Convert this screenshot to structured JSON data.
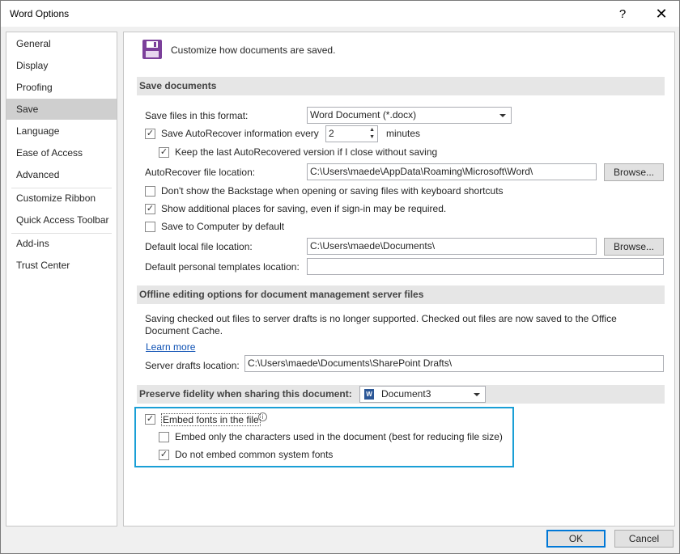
{
  "window": {
    "title": "Word Options",
    "help_label": "?",
    "close_label": "✕"
  },
  "sidebar": {
    "items": [
      {
        "label": "General"
      },
      {
        "label": "Display"
      },
      {
        "label": "Proofing"
      },
      {
        "label": "Save"
      },
      {
        "label": "Language"
      },
      {
        "label": "Ease of Access"
      },
      {
        "label": "Advanced"
      },
      {
        "label": "Customize Ribbon"
      },
      {
        "label": "Quick Access Toolbar"
      },
      {
        "label": "Add-ins"
      },
      {
        "label": "Trust Center"
      }
    ],
    "selected": "Save"
  },
  "main": {
    "header_text": "Customize how documents are saved.",
    "save_section": {
      "title": "Save documents",
      "format_label": "Save files in this format:",
      "format_value": "Word Document (*.docx)",
      "autorecover_label": "Save AutoRecover information every",
      "autorecover_checked": true,
      "autorecover_minutes_value": "2",
      "minutes_label": "minutes",
      "keep_last_label": "Keep the last AutoRecovered version if I close without saving",
      "keep_last_checked": true,
      "autorecover_location_label": "AutoRecover file location:",
      "autorecover_location_value": "C:\\Users\\maede\\AppData\\Roaming\\Microsoft\\Word\\",
      "browse_label": "Browse...",
      "backstage_label": "Don't show the Backstage when opening or saving files with keyboard shortcuts",
      "backstage_checked": false,
      "additional_places_label": "Show additional places for saving, even if sign-in may be required.",
      "additional_places_checked": true,
      "save_computer_label": "Save to Computer by default",
      "save_computer_checked": false,
      "default_local_label": "Default local file location:",
      "default_local_value": "C:\\Users\\maede\\Documents\\",
      "browse2_label": "Browse...",
      "templates_label": "Default personal templates location:",
      "templates_value": ""
    },
    "offline_section": {
      "title": "Offline editing options for document management server files",
      "info_text": "Saving checked out files to server drafts is no longer supported. Checked out files are now saved to the Office Document Cache.",
      "learn_more_label": "Learn more",
      "server_drafts_label": "Server drafts location:",
      "server_drafts_value": "C:\\Users\\maede\\Documents\\SharePoint Drafts\\"
    },
    "fidelity_section": {
      "title": "Preserve fidelity when sharing this document:",
      "document_value": "Document3",
      "embed_fonts_label": "Embed fonts in the file",
      "embed_fonts_checked": true,
      "embed_only_label": "Embed only the characters used in the document (best for reducing file size)",
      "embed_only_checked": false,
      "no_common_label": "Do not embed common system fonts",
      "no_common_checked": true
    }
  },
  "footer": {
    "ok_label": "OK",
    "cancel_label": "Cancel"
  },
  "colors": {
    "highlight": "#1a9fd6",
    "save_icon": "#7b3f9a",
    "selected_nav": "#cfcfcf"
  }
}
